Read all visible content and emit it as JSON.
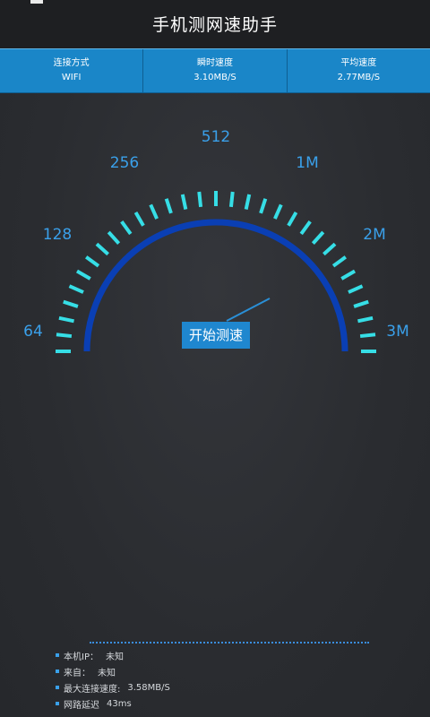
{
  "app": {
    "title": "手机测网速助手"
  },
  "stats": [
    {
      "label": "连接方式",
      "value": "WIFI"
    },
    {
      "label": "瞬时速度",
      "value": "3.10MB/S"
    },
    {
      "label": "平均速度",
      "value": "2.77MB/S"
    }
  ],
  "gauge": {
    "scale_labels": [
      "64",
      "128",
      "256",
      "512",
      "1M",
      "2M",
      "3M"
    ],
    "needle_color": "#2a8fd6",
    "arc_color": "#0a3fb4",
    "tick_color": "#36dee6",
    "start_button": "开始测速"
  },
  "info": [
    {
      "label": "本机IP：",
      "value": "未知"
    },
    {
      "label": "来自：",
      "value": "未知"
    },
    {
      "label": "最大连接速度:",
      "value": "3.58MB/S"
    },
    {
      "label": "网路延迟",
      "value": "43ms"
    }
  ]
}
